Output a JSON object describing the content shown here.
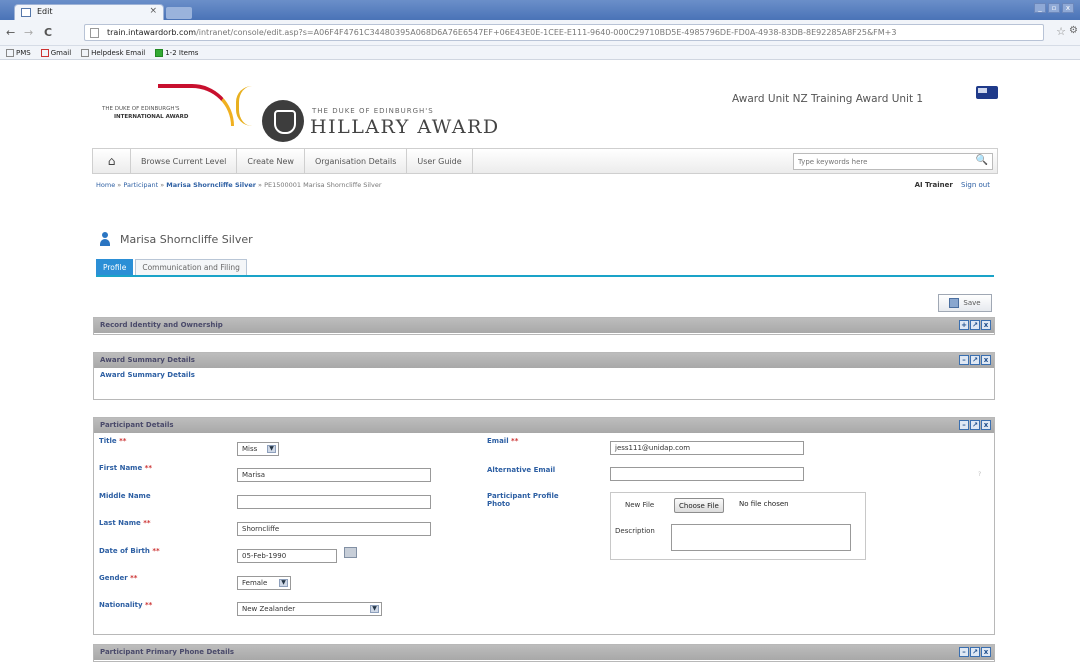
{
  "browser": {
    "tab_title": "Edit",
    "tab_close": "×",
    "url_domain": "train.intawardorb.com",
    "url_path": "/intranet/console/edit.asp?s=A06F4F4761C34480395A068D6A76E6547EF+06E43E0E-1CEE-E111-9640-000C29710BD5E-4985796DE-FD0A-4938-83DB-8E92285A8F25&FM+3",
    "bookmarks": [
      "PMS",
      "Gmail",
      "Helpdesk Email",
      "1-2 Items"
    ]
  },
  "header": {
    "logo_left_line1": "THE DUKE OF EDINBURGH'S",
    "logo_left_line2": "INTERNATIONAL AWARD",
    "brand_small": "THE DUKE OF EDINBURGH'S",
    "brand_big": "HILLARY AWARD",
    "unit_title": "Award Unit NZ Training Award Unit 1"
  },
  "nav": {
    "home_icon": "⌂",
    "items": [
      "Browse Current Level",
      "Create New",
      "Organisation Details",
      "User Guide"
    ],
    "search_placeholder": "Type keywords here",
    "search_icon": "🔍"
  },
  "breadcrumb": {
    "home": "Home",
    "participant": "Participant",
    "person": "Marisa Shorncliffe Silver",
    "record": "PE1500001 Marisa Shorncliffe Silver",
    "sep": "»"
  },
  "user": {
    "name": "AI Trainer",
    "sign_out": "Sign out"
  },
  "profile": {
    "name": "Marisa Shorncliffe Silver",
    "tabs": [
      "Profile",
      "Communication and Filing"
    ]
  },
  "save_label": "Save",
  "panels": {
    "record_identity": "Record Identity and Ownership",
    "award_summary": "Award Summary Details",
    "award_summary_link": "Award Summary Details",
    "participant_details": "Participant Details",
    "primary_phone": "Participant Primary Phone Details"
  },
  "form": {
    "req_mark": "**",
    "title_label": "Title",
    "title_value": "Miss",
    "first_name_label": "First Name",
    "first_name_value": "Marisa",
    "middle_name_label": "Middle Name",
    "middle_name_value": "",
    "last_name_label": "Last Name",
    "last_name_value": "Shorncliffe",
    "dob_label": "Date of Birth",
    "dob_value": "05-Feb-1990",
    "gender_label": "Gender",
    "gender_value": "Female",
    "nationality_label": "Nationality",
    "nationality_value": "New Zealander",
    "email_label": "Email",
    "email_value": "jess111@unidap.com",
    "alt_email_label": "Alternative Email",
    "alt_email_value": "",
    "photo_label_1": "Participant Profile",
    "photo_label_2": "Photo",
    "new_file_label": "New File",
    "choose_file": "Choose File",
    "no_file": "No file chosen",
    "description_label": "Description"
  }
}
